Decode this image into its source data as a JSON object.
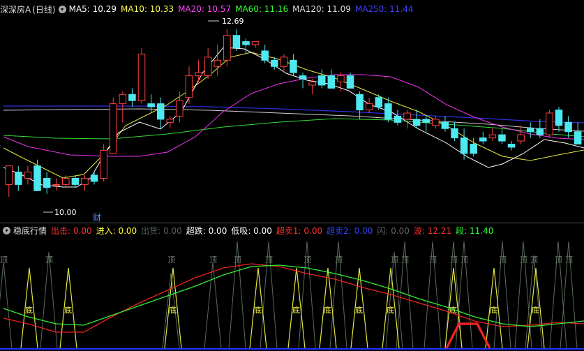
{
  "main_panel": {
    "stock_name": "深深房A",
    "period": "(日线)",
    "ma": [
      {
        "label": "MA5: 10.29",
        "color": "#ffffff"
      },
      {
        "label": "MA10: 10.33",
        "color": "#ffff55"
      },
      {
        "label": "MA20: 10.57",
        "color": "#ff44ff"
      },
      {
        "label": "MA60: 11.16",
        "color": "#33ff33"
      },
      {
        "label": "MA120: 11.09",
        "color": "#dddddd"
      },
      {
        "label": "MA250: 11.44",
        "color": "#4040ff"
      }
    ],
    "high_label": "12.69",
    "low_label": "10.00",
    "event_marker": "财"
  },
  "sub_panel": {
    "indicator_name": "稳底行情",
    "items": [
      {
        "label": "出击: 0.00",
        "color": "#ff3333"
      },
      {
        "label": "进入: 0.00",
        "color": "#ffff33"
      },
      {
        "label": "出货: 0.00",
        "color": "#556655"
      },
      {
        "label": "超跌: 0.00",
        "color": "#ffffff"
      },
      {
        "label": "低吸: 0.00",
        "color": "#ffffff"
      },
      {
        "label": "超卖1: 0.00",
        "color": "#ff3333"
      },
      {
        "label": "超卖2: 0.00",
        "color": "#3344ff"
      },
      {
        "label": "闪: 0.00",
        "color": "#666666"
      },
      {
        "label": "波: 12.21",
        "color": "#ff3333"
      },
      {
        "label": "段: 11.40",
        "color": "#33ff33"
      }
    ],
    "bottom_label": "底",
    "top_label": "顶"
  },
  "chart_data": {
    "type": "candlestick",
    "y_range": [
      9.8,
      12.9
    ],
    "candles": [
      [
        10.2,
        10.5,
        10.0,
        10.5
      ],
      [
        10.4,
        10.5,
        10.1,
        10.2
      ],
      [
        10.3,
        10.5,
        10.2,
        10.4
      ],
      [
        10.5,
        10.6,
        10.1,
        10.1
      ],
      [
        10.3,
        10.4,
        10.05,
        10.15
      ],
      [
        10.2,
        10.3,
        10.1,
        10.2
      ],
      [
        10.2,
        10.35,
        10.15,
        10.3
      ],
      [
        10.3,
        10.35,
        10.15,
        10.2
      ],
      [
        10.2,
        10.35,
        10.1,
        10.3
      ],
      [
        10.35,
        10.4,
        10.2,
        10.25
      ],
      [
        10.3,
        10.85,
        10.25,
        10.75
      ],
      [
        10.7,
        11.6,
        10.7,
        11.5
      ],
      [
        11.5,
        11.7,
        11.2,
        11.65
      ],
      [
        11.65,
        11.75,
        11.45,
        11.55
      ],
      [
        11.55,
        12.4,
        11.5,
        12.3
      ],
      [
        11.5,
        11.65,
        11.35,
        11.45
      ],
      [
        11.5,
        11.6,
        11.1,
        11.25
      ],
      [
        11.2,
        11.3,
        11.1,
        11.25
      ],
      [
        11.3,
        11.7,
        11.2,
        11.55
      ],
      [
        11.6,
        12.1,
        11.5,
        11.95
      ],
      [
        11.95,
        12.2,
        11.85,
        12.0
      ],
      [
        11.95,
        12.4,
        11.9,
        12.25
      ],
      [
        12.1,
        12.45,
        11.95,
        12.2
      ],
      [
        12.2,
        12.7,
        12.1,
        12.6
      ],
      [
        12.6,
        12.7,
        12.35,
        12.4
      ],
      [
        12.5,
        12.55,
        12.3,
        12.45
      ],
      [
        12.45,
        12.5,
        12.4,
        12.5
      ],
      [
        12.35,
        12.45,
        12.15,
        12.2
      ],
      [
        12.2,
        12.25,
        12.05,
        12.1
      ],
      [
        12.1,
        12.3,
        12.0,
        12.25
      ],
      [
        12.2,
        12.3,
        11.95,
        12.0
      ],
      [
        11.95,
        12.0,
        11.75,
        11.9
      ],
      [
        11.8,
        11.9,
        11.65,
        11.85
      ],
      [
        11.95,
        12.05,
        11.75,
        11.8
      ],
      [
        11.95,
        12.05,
        11.75,
        11.75
      ],
      [
        11.85,
        12.0,
        11.7,
        11.95
      ],
      [
        11.95,
        12.0,
        11.75,
        11.75
      ],
      [
        11.65,
        11.7,
        11.25,
        11.4
      ],
      [
        11.4,
        11.6,
        11.35,
        11.5
      ],
      [
        11.6,
        11.65,
        11.4,
        11.45
      ],
      [
        11.5,
        11.6,
        11.2,
        11.25
      ],
      [
        11.3,
        11.4,
        11.15,
        11.2
      ],
      [
        11.25,
        11.4,
        11.1,
        11.35
      ],
      [
        11.25,
        11.4,
        11.1,
        11.15
      ],
      [
        11.25,
        11.3,
        11.05,
        11.2
      ],
      [
        11.15,
        11.3,
        11.1,
        11.25
      ],
      [
        11.2,
        11.3,
        11.05,
        11.1
      ],
      [
        11.1,
        11.2,
        10.9,
        10.95
      ],
      [
        10.95,
        11.1,
        10.6,
        10.7
      ],
      [
        10.85,
        10.95,
        10.65,
        10.7
      ],
      [
        10.95,
        11.05,
        10.85,
        10.9
      ],
      [
        10.95,
        11.1,
        10.9,
        11.0
      ],
      [
        11.0,
        11.1,
        10.85,
        10.9
      ],
      [
        10.85,
        10.9,
        10.75,
        10.8
      ],
      [
        10.9,
        11.15,
        10.85,
        11.0
      ],
      [
        11.1,
        11.2,
        10.95,
        11.05
      ],
      [
        11.1,
        11.25,
        10.95,
        11.0
      ],
      [
        11.0,
        11.4,
        10.95,
        11.35
      ],
      [
        11.4,
        11.45,
        11.05,
        11.15
      ],
      [
        11.2,
        11.3,
        10.95,
        11.05
      ],
      [
        11.05,
        11.2,
        10.85,
        10.85
      ]
    ]
  }
}
